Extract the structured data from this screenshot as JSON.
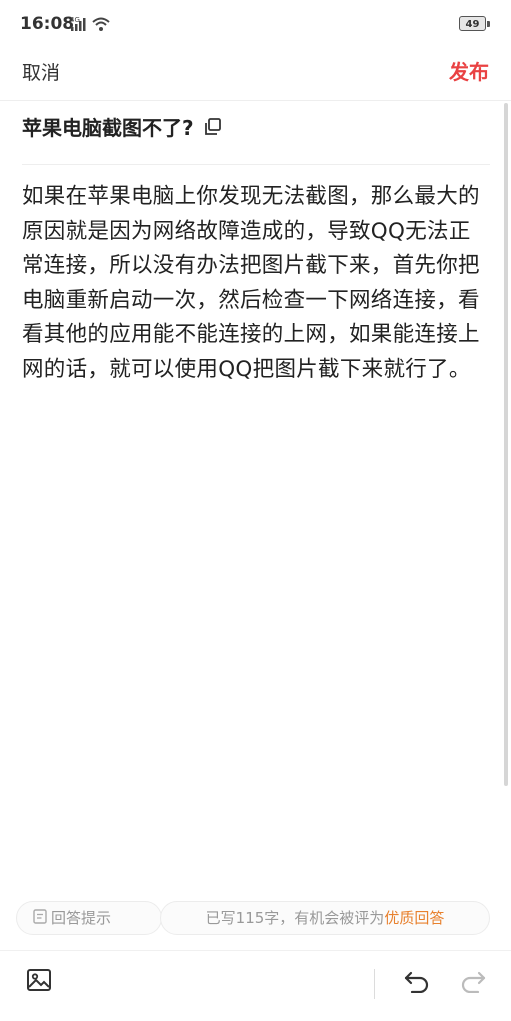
{
  "status": {
    "time": "16:08",
    "network": "4G",
    "battery": "49"
  },
  "nav": {
    "cancel_label": "取消",
    "publish_label": "发布"
  },
  "question": {
    "title": "苹果电脑截图不了?"
  },
  "answer": {
    "text": "如果在苹果电脑上你发现无法截图，那么最大的原因就是因为网络故障造成的，导致QQ无法正常连接，所以没有办法把图片截下来，首先你把电脑重新启动一次，然后检查一下网络连接，看看其他的应用能不能连接的上网，如果能连接上网的话，就可以使用QQ把图片截下来就行了。"
  },
  "hints": {
    "tips_label": "回答提示",
    "count_text": "已写115字，有机会被评为",
    "quality_label": "优质回答"
  },
  "colors": {
    "accent_red": "#e94243",
    "highlight_orange": "#e8812e"
  },
  "icons": [
    "signal-icon",
    "wifi-icon",
    "copy-icon",
    "doc-icon",
    "image-icon",
    "undo-icon",
    "redo-icon"
  ]
}
